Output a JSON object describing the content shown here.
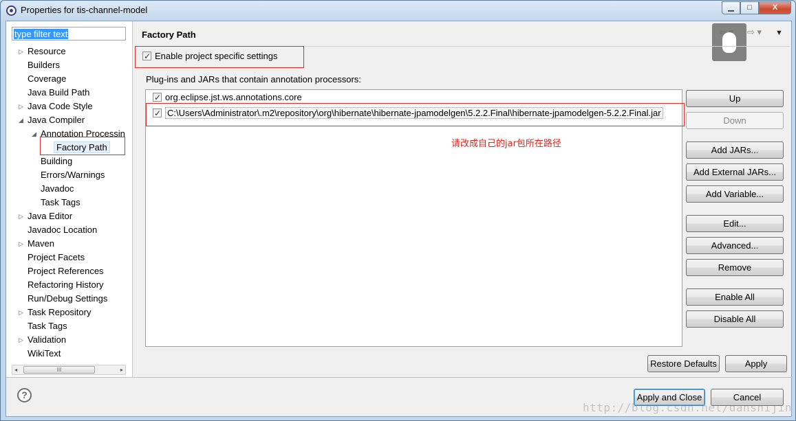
{
  "window": {
    "title": "Properties for tis-channel-model",
    "minimize": "▁",
    "maximize": "□",
    "close": "X"
  },
  "filter": {
    "value": "type filter text"
  },
  "tree": [
    {
      "label": "Resource",
      "expander": "▷"
    },
    {
      "label": "Builders"
    },
    {
      "label": "Coverage"
    },
    {
      "label": "Java Build Path"
    },
    {
      "label": "Java Code Style",
      "expander": "▷"
    },
    {
      "label": "Java Compiler",
      "expander": "◢"
    },
    {
      "label": "Annotation Processin",
      "expander": "◢"
    },
    {
      "label": "Factory Path"
    },
    {
      "label": "Building"
    },
    {
      "label": "Errors/Warnings"
    },
    {
      "label": "Javadoc"
    },
    {
      "label": "Task Tags"
    },
    {
      "label": "Java Editor",
      "expander": "▷"
    },
    {
      "label": "Javadoc Location"
    },
    {
      "label": "Maven",
      "expander": "▷"
    },
    {
      "label": "Project Facets"
    },
    {
      "label": "Project References"
    },
    {
      "label": "Refactoring History"
    },
    {
      "label": "Run/Debug Settings"
    },
    {
      "label": "Task Repository",
      "expander": "▷"
    },
    {
      "label": "Task Tags"
    },
    {
      "label": "Validation",
      "expander": "▷"
    },
    {
      "label": "WikiText"
    }
  ],
  "hscroll": {
    "left": "◂",
    "thumb": "III",
    "right": "▸"
  },
  "page": {
    "title": "Factory Path",
    "nav_back": "⇦ ▾",
    "nav_forward": "⇨ ▾",
    "nav_menu": "▼",
    "enable_label": "Enable project specific settings",
    "plugins_label": "Plug-ins and JARs that contain annotation processors:",
    "jars": [
      "org.eclipse.jst.ws.annotations.core",
      "C:\\Users\\Administrator\\.m2\\repository\\org\\hibernate\\hibernate-jpamodelgen\\5.2.2.Final\\hibernate-jpamodelgen-5.2.2.Final.jar"
    ],
    "annotation": "请改成自己的jar包所在路径"
  },
  "buttons": {
    "up": "Up",
    "down": "Down",
    "add_jars": "Add JARs...",
    "add_external_jars": "Add External JARs...",
    "add_variable": "Add Variable...",
    "edit": "Edit...",
    "advanced": "Advanced...",
    "remove": "Remove",
    "enable_all": "Enable All",
    "disable_all": "Disable All",
    "restore_defaults": "Restore Defaults",
    "apply": "Apply",
    "apply_and_close": "Apply and Close",
    "cancel": "Cancel"
  },
  "help": "?",
  "watermark": "http://blog.csdn.net/danshijin"
}
